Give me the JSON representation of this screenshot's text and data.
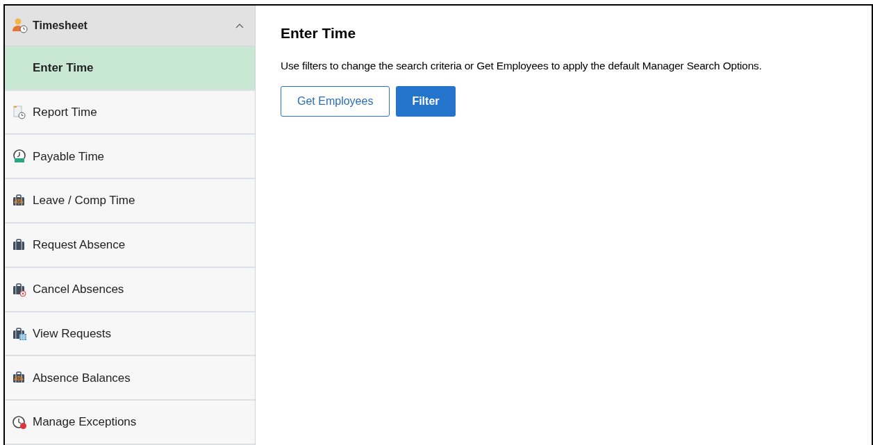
{
  "sidebar": {
    "group": {
      "label": "Timesheet",
      "expanded": true
    },
    "items": [
      {
        "label": "Enter Time",
        "kind": "sub",
        "selected": true
      },
      {
        "label": "Report Time",
        "kind": "report",
        "selected": false
      },
      {
        "label": "Payable Time",
        "kind": "payable",
        "selected": false
      },
      {
        "label": "Leave / Comp Time",
        "kind": "scales",
        "selected": false
      },
      {
        "label": "Request Absence",
        "kind": "case",
        "selected": false
      },
      {
        "label": "Cancel Absences",
        "kind": "cancel",
        "selected": false
      },
      {
        "label": "View Requests",
        "kind": "calendar",
        "selected": false
      },
      {
        "label": "Absence Balances",
        "kind": "scales",
        "selected": false
      },
      {
        "label": "Manage Exceptions",
        "kind": "exception",
        "selected": false
      }
    ]
  },
  "main": {
    "title": "Enter Time",
    "description": "Use filters to change the search criteria or Get Employees to apply the default Manager Search Options.",
    "buttons": [
      {
        "label": "Get Employees",
        "kind": "secondary"
      },
      {
        "label": "Filter",
        "kind": "primary"
      }
    ]
  }
}
